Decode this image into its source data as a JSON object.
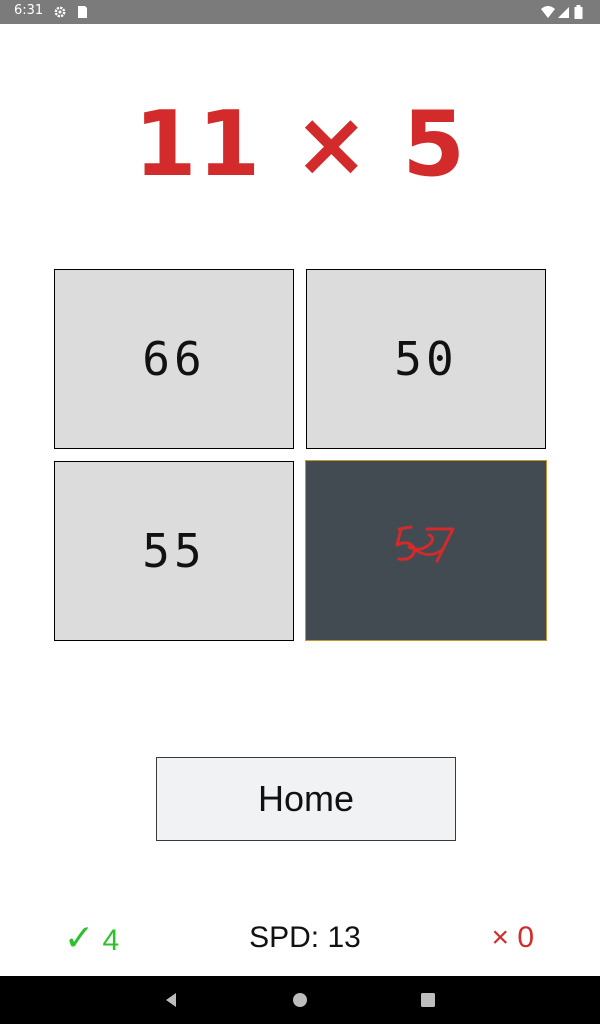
{
  "status_bar": {
    "time": "6:31",
    "icons": [
      "gear-icon",
      "sd-card-icon",
      "wifi-icon",
      "signal-icon",
      "battery-icon"
    ]
  },
  "question": {
    "text": "11 × 5",
    "color": "#d32b2b"
  },
  "answers": [
    {
      "label": "66",
      "state": "default"
    },
    {
      "label": "50",
      "state": "default"
    },
    {
      "label": "55",
      "state": "default"
    },
    {
      "label": "57",
      "state": "wrong-selected"
    }
  ],
  "home_button": {
    "label": "Home"
  },
  "footer": {
    "correct_symbol": "✓",
    "correct_count": "4",
    "speed": "SPD: 13",
    "incorrect_symbol": "×",
    "incorrect_count": "0"
  },
  "colors": {
    "accent_red": "#d32b2b",
    "correct_green": "#2cc12c",
    "tile_bg": "#dcdcdc",
    "wrong_tile_bg": "#424a52"
  }
}
